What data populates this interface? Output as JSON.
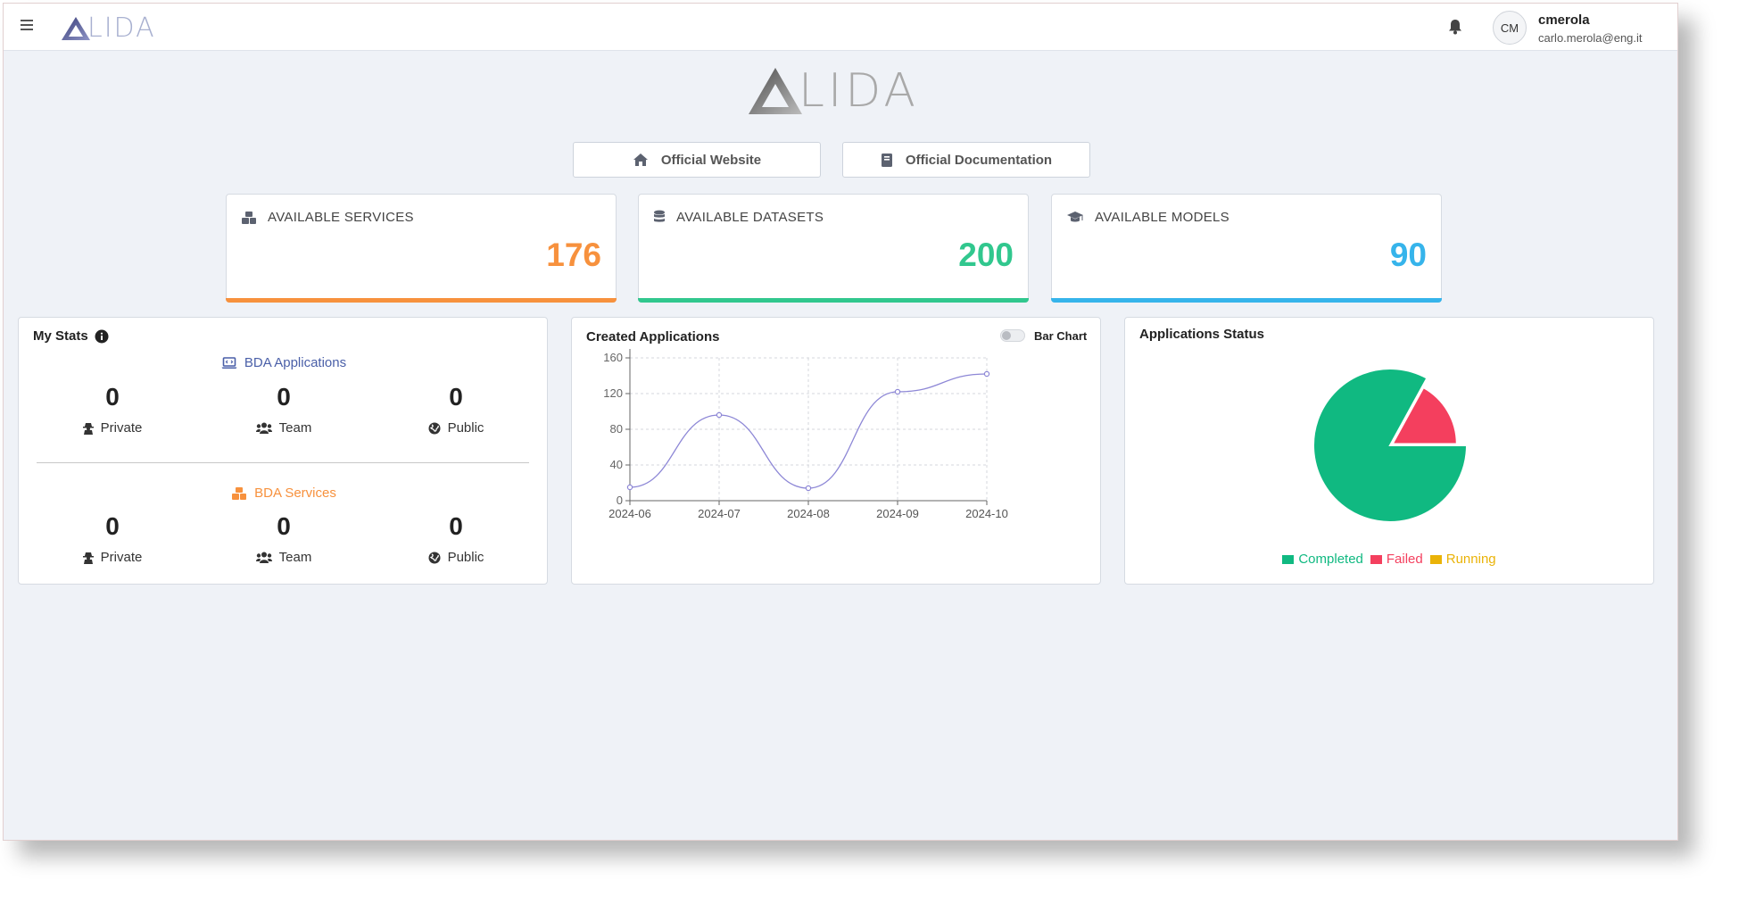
{
  "app": {
    "logo_text": "LIDA",
    "user": {
      "initials": "CM",
      "name": "cmerola",
      "email": "carlo.merola@eng.it"
    }
  },
  "links": {
    "website": "Official Website",
    "docs": "Official Documentation"
  },
  "cards": [
    {
      "title": "AVAILABLE SERVICES",
      "value": "176",
      "color": "#f7913d",
      "icon": "cubes-icon"
    },
    {
      "title": "AVAILABLE DATASETS",
      "value": "200",
      "color": "#31c78e",
      "icon": "database-icon"
    },
    {
      "title": "AVAILABLE MODELS",
      "value": "90",
      "color": "#36b4eb",
      "icon": "graduation-cap-icon"
    }
  ],
  "my_stats": {
    "title": "My Stats",
    "applications": {
      "title": "BDA Applications",
      "color": "#4a5fa8",
      "private": "0",
      "team": "0",
      "public": "0"
    },
    "services": {
      "title": "BDA Services",
      "color": "#f7913d",
      "private": "0",
      "team": "0",
      "public": "0"
    },
    "labels": {
      "private": "Private",
      "team": "Team",
      "public": "Public"
    }
  },
  "created_applications": {
    "title": "Created Applications",
    "toggle_label": "Bar Chart",
    "toggle_on": false
  },
  "applications_status": {
    "title": "Applications Status",
    "legend": [
      {
        "label": "Completed",
        "color": "#10b981"
      },
      {
        "label": "Failed",
        "color": "#f43f5e"
      },
      {
        "label": "Running",
        "color": "#eab308"
      }
    ]
  },
  "chart_data": [
    {
      "type": "line",
      "title": "Created Applications",
      "categories": [
        "2024-06",
        "2024-07",
        "2024-08",
        "2024-09",
        "2024-10"
      ],
      "yticks": [
        "0",
        "40",
        "80",
        "120",
        "160"
      ],
      "series": [
        {
          "values": [
            15,
            96,
            14,
            122,
            142
          ],
          "color": "#8d87d6"
        }
      ],
      "ylim": [
        0,
        160
      ],
      "grid": true
    },
    {
      "type": "pie",
      "title": "Applications Status",
      "series": [
        {
          "name": "Completed",
          "values": [
            83
          ]
        },
        {
          "name": "Failed",
          "values": [
            17
          ]
        },
        {
          "name": "Running",
          "values": [
            0
          ]
        }
      ]
    }
  ]
}
